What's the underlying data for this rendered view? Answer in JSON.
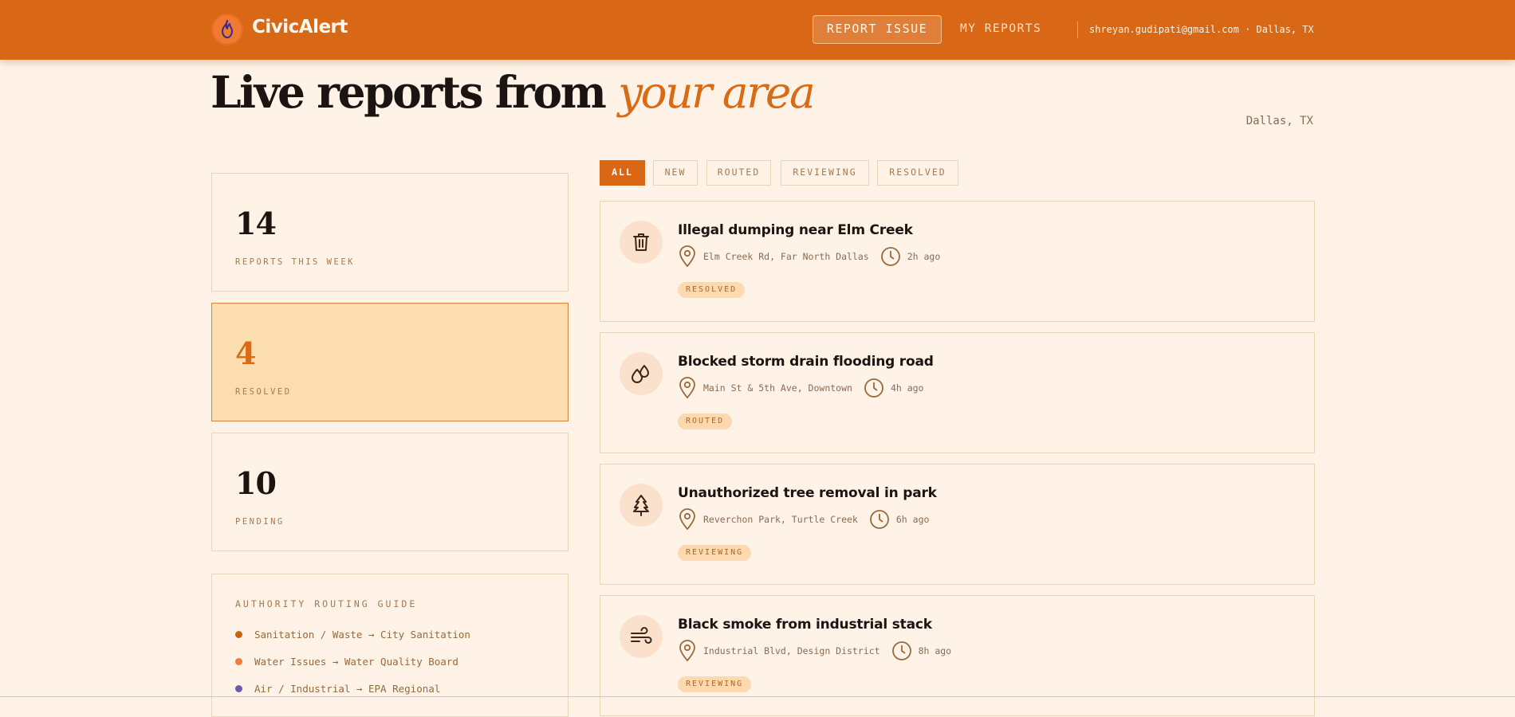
{
  "header": {
    "brand": "CivicAlert",
    "report_button": "REPORT ISSUE",
    "my_reports": "MY REPORTS",
    "user": "shreyan.gudipati@gmail.com · Dallas, TX"
  },
  "hero": {
    "title_main": "Live reports from ",
    "title_accent": "your area",
    "location": "Dallas, TX"
  },
  "stats": [
    {
      "value": "14",
      "label": "REPORTS THIS WEEK"
    },
    {
      "value": "4",
      "label": "RESOLVED"
    },
    {
      "value": "10",
      "label": "PENDING"
    }
  ],
  "routing_guide": {
    "title": "AUTHORITY ROUTING GUIDE",
    "items": [
      {
        "text": "Sanitation / Waste → City Sanitation",
        "color": "#c8620f"
      },
      {
        "text": "Water Issues → Water Quality Board",
        "color": "#ee7d3c"
      },
      {
        "text": "Air / Industrial → EPA Regional",
        "color": "#6a5ab0"
      }
    ]
  },
  "filters": [
    "ALL",
    "NEW",
    "ROUTED",
    "REVIEWING",
    "RESOLVED"
  ],
  "filters_active": "ALL",
  "reports": [
    {
      "icon": "trash-icon",
      "title": "Illegal dumping near Elm Creek",
      "location": "Elm Creek Rd, Far North Dallas",
      "time": "2h ago",
      "status": "RESOLVED"
    },
    {
      "icon": "water-drops-icon",
      "title": "Blocked storm drain flooding road",
      "location": "Main St & 5th Ave, Downtown",
      "time": "4h ago",
      "status": "ROUTED"
    },
    {
      "icon": "tree-icon",
      "title": "Unauthorized tree removal in park",
      "location": "Reverchon Park, Turtle Creek",
      "time": "6h ago",
      "status": "REVIEWING"
    },
    {
      "icon": "wind-smoke-icon",
      "title": "Black smoke from industrial stack",
      "location": "Industrial Blvd, Design District",
      "time": "8h ago",
      "status": "REVIEWING"
    }
  ],
  "colors": {
    "accent": "#d86816",
    "background": "#fff3e8",
    "highlight": "#fcddb0"
  }
}
